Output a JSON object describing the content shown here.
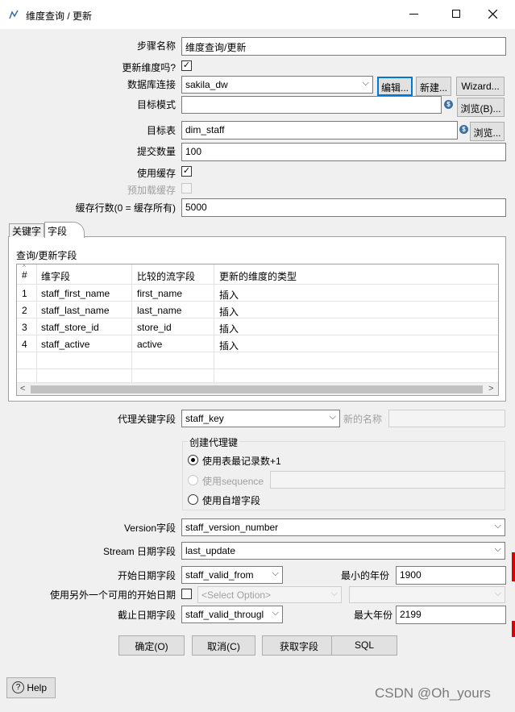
{
  "window": {
    "title": "维度查询 / 更新"
  },
  "form": {
    "step_name_label": "步骤名称",
    "step_name_value": "维度查询/更新",
    "update_dim_label": "更新维度吗?",
    "update_dim_checked": true,
    "db_conn_label": "数据库连接",
    "db_conn_value": "sakila_dw",
    "edit_btn": "编辑...",
    "new_btn": "新建...",
    "wizard_btn": "Wizard...",
    "target_schema_label": "目标模式",
    "target_schema_value": "",
    "browse_schema_btn": "浏览(B)...",
    "target_table_label": "目标表",
    "target_table_value": "dim_staff",
    "browse_table_btn": "浏览...",
    "commit_size_label": "提交数量",
    "commit_size_value": "100",
    "use_cache_label": "使用缓存",
    "use_cache_checked": true,
    "preload_cache_label": "预加载缓存",
    "cache_rows_label": "缓存行数(0 = 缓存所有)",
    "cache_rows_value": "5000"
  },
  "tabs": [
    {
      "label": "关键字"
    },
    {
      "label": "字段"
    }
  ],
  "fields_section": {
    "title": "查询/更新字段",
    "columns": [
      "#",
      "维字段",
      "比较的流字段",
      "更新的维度的类型"
    ],
    "rows": [
      [
        "1",
        "staff_first_name",
        "first_name",
        "插入"
      ],
      [
        "2",
        "staff_last_name",
        "last_name",
        "插入"
      ],
      [
        "3",
        "staff_store_id",
        "store_id",
        "插入"
      ],
      [
        "4",
        "staff_active",
        "active",
        "插入"
      ]
    ]
  },
  "surrogate": {
    "key_label": "代理关键字段",
    "key_value": "staff_key",
    "new_name_label": "新的名称",
    "new_name_value": "",
    "group_title": "创建代理键",
    "opt_table_max": "使用表最记录数+1",
    "opt_sequence": "使用sequence",
    "opt_auto_inc": "使用自增字段"
  },
  "versioning": {
    "version_label": "Version字段",
    "version_value": "staff_version_number",
    "stream_date_label": "Stream 日期字段",
    "stream_date_value": "last_update",
    "start_date_label": "开始日期字段",
    "start_date_value": "staff_valid_from",
    "min_year_label": "最小的年份",
    "min_year_value": "1900",
    "alt_start_label": "使用另外一个可用的开始日期",
    "alt_start_select": "<Select Option>",
    "end_date_label": "截止日期字段",
    "end_date_value": "staff_valid_througl",
    "max_year_label": "最大年份",
    "max_year_value": "2199"
  },
  "buttons": {
    "ok": "确定(O)",
    "cancel": "取消(C)",
    "get_fields": "获取字段",
    "sql": "SQL"
  },
  "help_btn": "Help",
  "watermark": "CSDN @Oh_yours",
  "colors": {
    "focus_blue": "#0078d7",
    "variable_icon": "#3a6ea5",
    "right_red_marker": "#dd0000"
  }
}
